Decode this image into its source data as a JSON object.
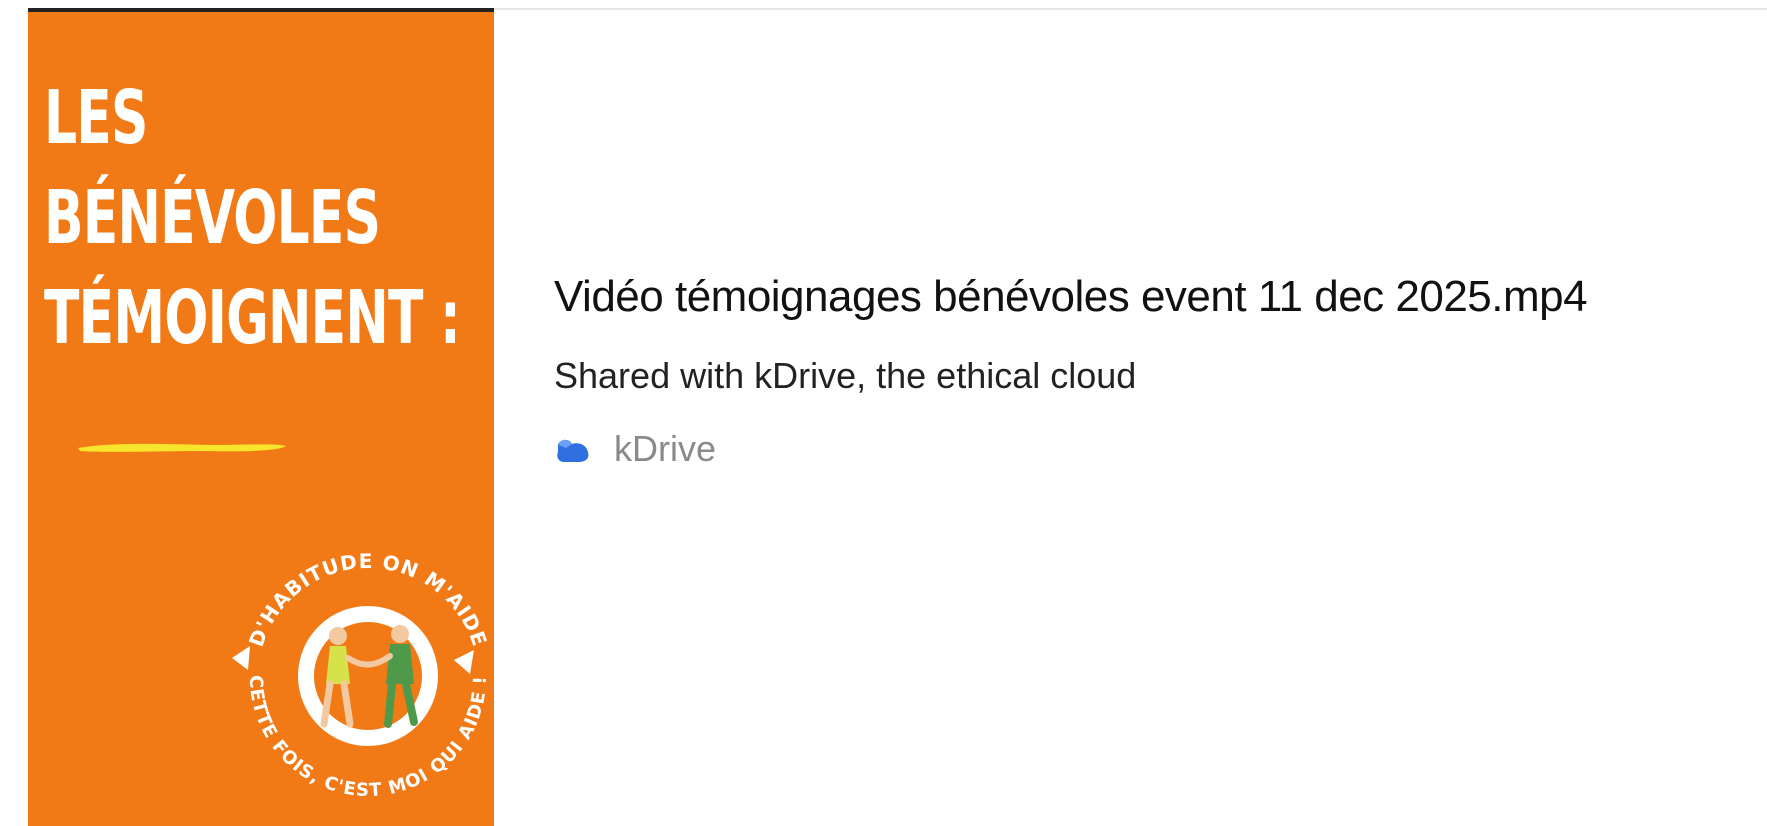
{
  "thumbnail": {
    "title_lines": [
      "LES",
      "BÉNÉVOLES",
      "TÉMOIGNENT :"
    ],
    "badge_text_top": "D'HABITUDE ON M'AIDE",
    "badge_text_bottom": "CETTE FOIS, C'EST MOI QUI AIDE !",
    "background_color": "#f27a16",
    "accent_color": "#f6e52c"
  },
  "link_preview": {
    "title": "Vidéo témoignages bénévoles event 11 dec 2025.mp4",
    "description": "Shared with kDrive, the ethical cloud",
    "provider": {
      "name": "kDrive",
      "icon": "kdrive-cloud-icon",
      "icon_color": "#2f6fe0"
    }
  }
}
